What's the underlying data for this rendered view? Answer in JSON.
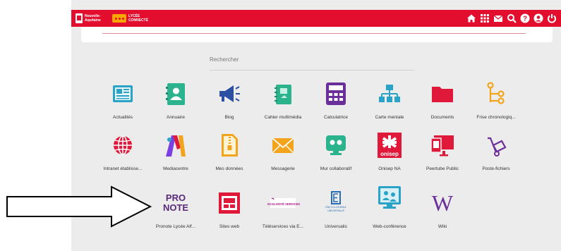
{
  "header": {
    "region_logo_text": [
      "Nouvelle-",
      "Aquitaine"
    ],
    "lycee_logo_text": [
      "LYCÉE",
      "CONNECTÉ"
    ],
    "icons": [
      "home-icon",
      "apps-grid-icon",
      "mail-icon",
      "search-icon",
      "help-icon",
      "user-icon",
      "power-icon"
    ]
  },
  "search": {
    "placeholder": "Rechercher"
  },
  "apps": [
    {
      "label": "Actualités",
      "icon": "news-icon",
      "color": "#2aa3c9"
    },
    {
      "label": "Annuaire",
      "icon": "address-book-icon",
      "color": "#2bb38e"
    },
    {
      "label": "Blog",
      "icon": "megaphone-icon",
      "color": "#2a4fa3"
    },
    {
      "label": "Cahier multimédia",
      "icon": "notebook-icon",
      "color": "#2bb38e"
    },
    {
      "label": "Calculatrice",
      "icon": "calculator-icon",
      "color": "#6b2f9a"
    },
    {
      "label": "Carte mentale",
      "icon": "mindmap-icon",
      "color": "#2aa3c9"
    },
    {
      "label": "Documents",
      "icon": "folder-icon",
      "color": "#e0193a"
    },
    {
      "label": "Frise chronologiq...",
      "icon": "timeline-icon",
      "color": "#f2a51c"
    },
    {
      "label": "Intranet établisse...",
      "icon": "globe-icon",
      "color": "#e0193a"
    },
    {
      "label": "Mediacentre",
      "icon": "mediacentre-icon",
      "color": "#7b3fe4"
    },
    {
      "label": "Mes données",
      "icon": "zip-file-icon",
      "color": "#f2a51c"
    },
    {
      "label": "Messagerie",
      "icon": "envelope-icon",
      "color": "#f2a51c"
    },
    {
      "label": "Mur collaboratif",
      "icon": "collaboration-icon",
      "color": "#2bb38e"
    },
    {
      "label": "Onisep NA",
      "icon": "onisep-logo",
      "color": "#e0193a"
    },
    {
      "label": "Peertube Public",
      "icon": "video-screen-icon",
      "color": "#e0193a"
    },
    {
      "label": "Poste-fichiers",
      "icon": "hand-truck-icon",
      "color": "#6b2f9a"
    },
    {
      "label": "Pronote Lycée Alf...",
      "icon": "pronote-logo",
      "color": "#5a2a7a"
    },
    {
      "label": "Sites web",
      "icon": "website-icon",
      "color": "#e0193a"
    },
    {
      "label": "Téléservices via E...",
      "icon": "scolarite-services-logo",
      "color": "#6b2f9a"
    },
    {
      "label": "Universalis",
      "icon": "universalis-logo",
      "color": "#2a6fb3"
    },
    {
      "label": "Web-conférence",
      "icon": "web-conference-icon",
      "color": "#2aa3c9"
    },
    {
      "label": "Wiki",
      "icon": "wikipedia-icon",
      "color": "#6b2f9a"
    }
  ],
  "logos": {
    "onisep": "onisep",
    "pronote": [
      "PRO",
      "NOTE"
    ],
    "scolarite": "SCOLARITÉ SERVICES",
    "universalis": [
      "ENCYCLOPÆDIA",
      "UNIVERSALIS"
    ],
    "wiki": "W"
  }
}
